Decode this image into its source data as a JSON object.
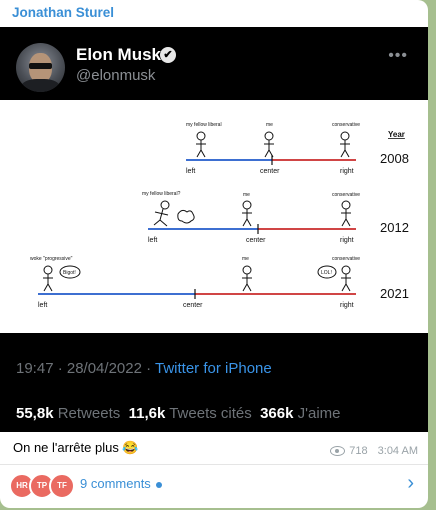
{
  "message": {
    "sender": "Jonathan Sturel",
    "caption": "On ne l'arrête plus 😂",
    "views": "718",
    "time": "3:04 AM",
    "comments_label": "9 comments",
    "commenter_avatars": [
      "HR",
      "TP",
      "TF"
    ]
  },
  "tweet": {
    "name": "Elon Musk",
    "handle": "@elonmusk",
    "verified_icon": "✔",
    "more_icon": "•••",
    "timestamp": "19:47 · 28/04/2022 · ",
    "source": "Twitter for iPhone",
    "stats": [
      {
        "value": "55,8k",
        "label": "Retweets"
      },
      {
        "value": "11,6k",
        "label": "Tweets cités"
      },
      {
        "value": "366k",
        "label": "J'aime"
      }
    ]
  },
  "meme": {
    "year_header": "Year",
    "rows": [
      {
        "year": "2008",
        "left": "left",
        "center": "center",
        "right": "right",
        "liberal_label": "my fellow liberal",
        "me_label": "me",
        "conservative_label": "conservative"
      },
      {
        "year": "2012",
        "left": "left",
        "center": "center",
        "right": "right",
        "liberal_label": "my fellow liberal?",
        "me_label": "me",
        "conservative_label": "conservative"
      },
      {
        "year": "2021",
        "left": "left",
        "center": "center",
        "right": "right",
        "liberal_label": "woke \"progressive\"",
        "me_label": "me",
        "conservative_label": "conservative",
        "bigot_bubble": "Bigot!",
        "lol_bubble": "LOL!"
      }
    ]
  },
  "colors": {
    "left_line": "#3d6fd1",
    "right_line": "#d04545",
    "link": "#3a8fd6",
    "avatar_red": "#ea6a61"
  },
  "icons": {
    "eye": "eye-icon",
    "chevron": "chevron-right-icon"
  }
}
